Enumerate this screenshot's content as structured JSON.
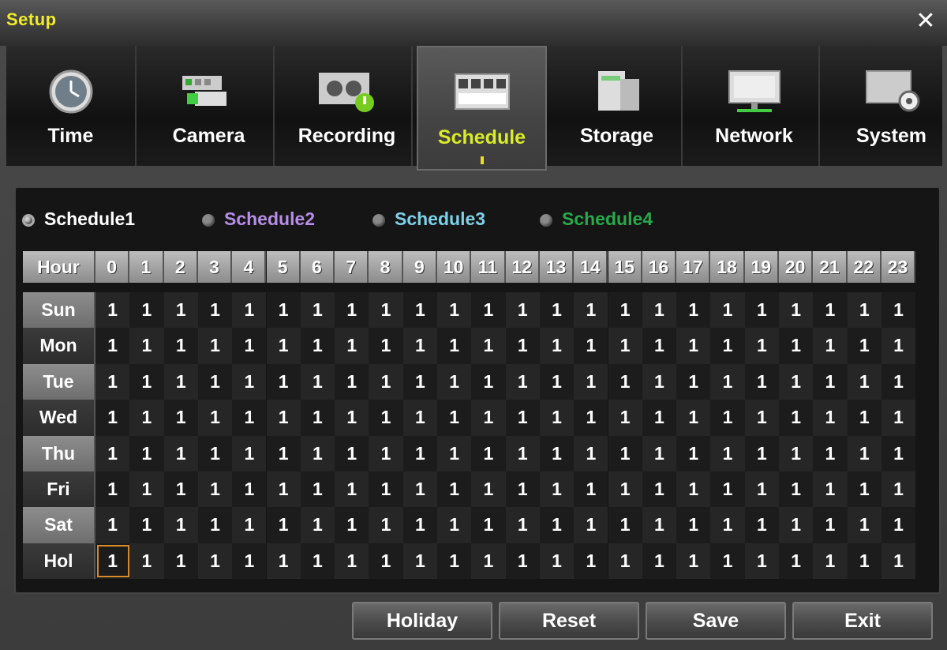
{
  "window": {
    "title": "Setup",
    "close_icon": "close-icon"
  },
  "tabs": [
    {
      "label": "Time",
      "icon": "clock-icon"
    },
    {
      "label": "Camera",
      "icon": "camera-icon"
    },
    {
      "label": "Recording",
      "icon": "recorder-icon"
    },
    {
      "label": "Schedule",
      "icon": "calendar-icon",
      "active": true
    },
    {
      "label": "Storage",
      "icon": "storage-icon"
    },
    {
      "label": "Network",
      "icon": "monitor-icon"
    },
    {
      "label": "System",
      "icon": "system-gear-icon"
    }
  ],
  "schedules": [
    {
      "label": "Schedule1",
      "color": "#ffffff",
      "selected": true
    },
    {
      "label": "Schedule2",
      "color": "#b58ee6",
      "selected": false
    },
    {
      "label": "Schedule3",
      "color": "#7fd0e8",
      "selected": false
    },
    {
      "label": "Schedule4",
      "color": "#2aa84a",
      "selected": false
    }
  ],
  "grid": {
    "header_label": "Hour",
    "hours": [
      "0",
      "1",
      "2",
      "3",
      "4",
      "5",
      "6",
      "7",
      "8",
      "9",
      "10",
      "11",
      "12",
      "13",
      "14",
      "15",
      "16",
      "17",
      "18",
      "19",
      "20",
      "21",
      "22",
      "23"
    ],
    "days": [
      "Sun",
      "Mon",
      "Tue",
      "Wed",
      "Thu",
      "Fri",
      "Sat",
      "Hol"
    ],
    "cell_value": "1"
  },
  "buttons": {
    "holiday": "Holiday",
    "reset": "Reset",
    "save": "Save",
    "exit": "Exit"
  }
}
